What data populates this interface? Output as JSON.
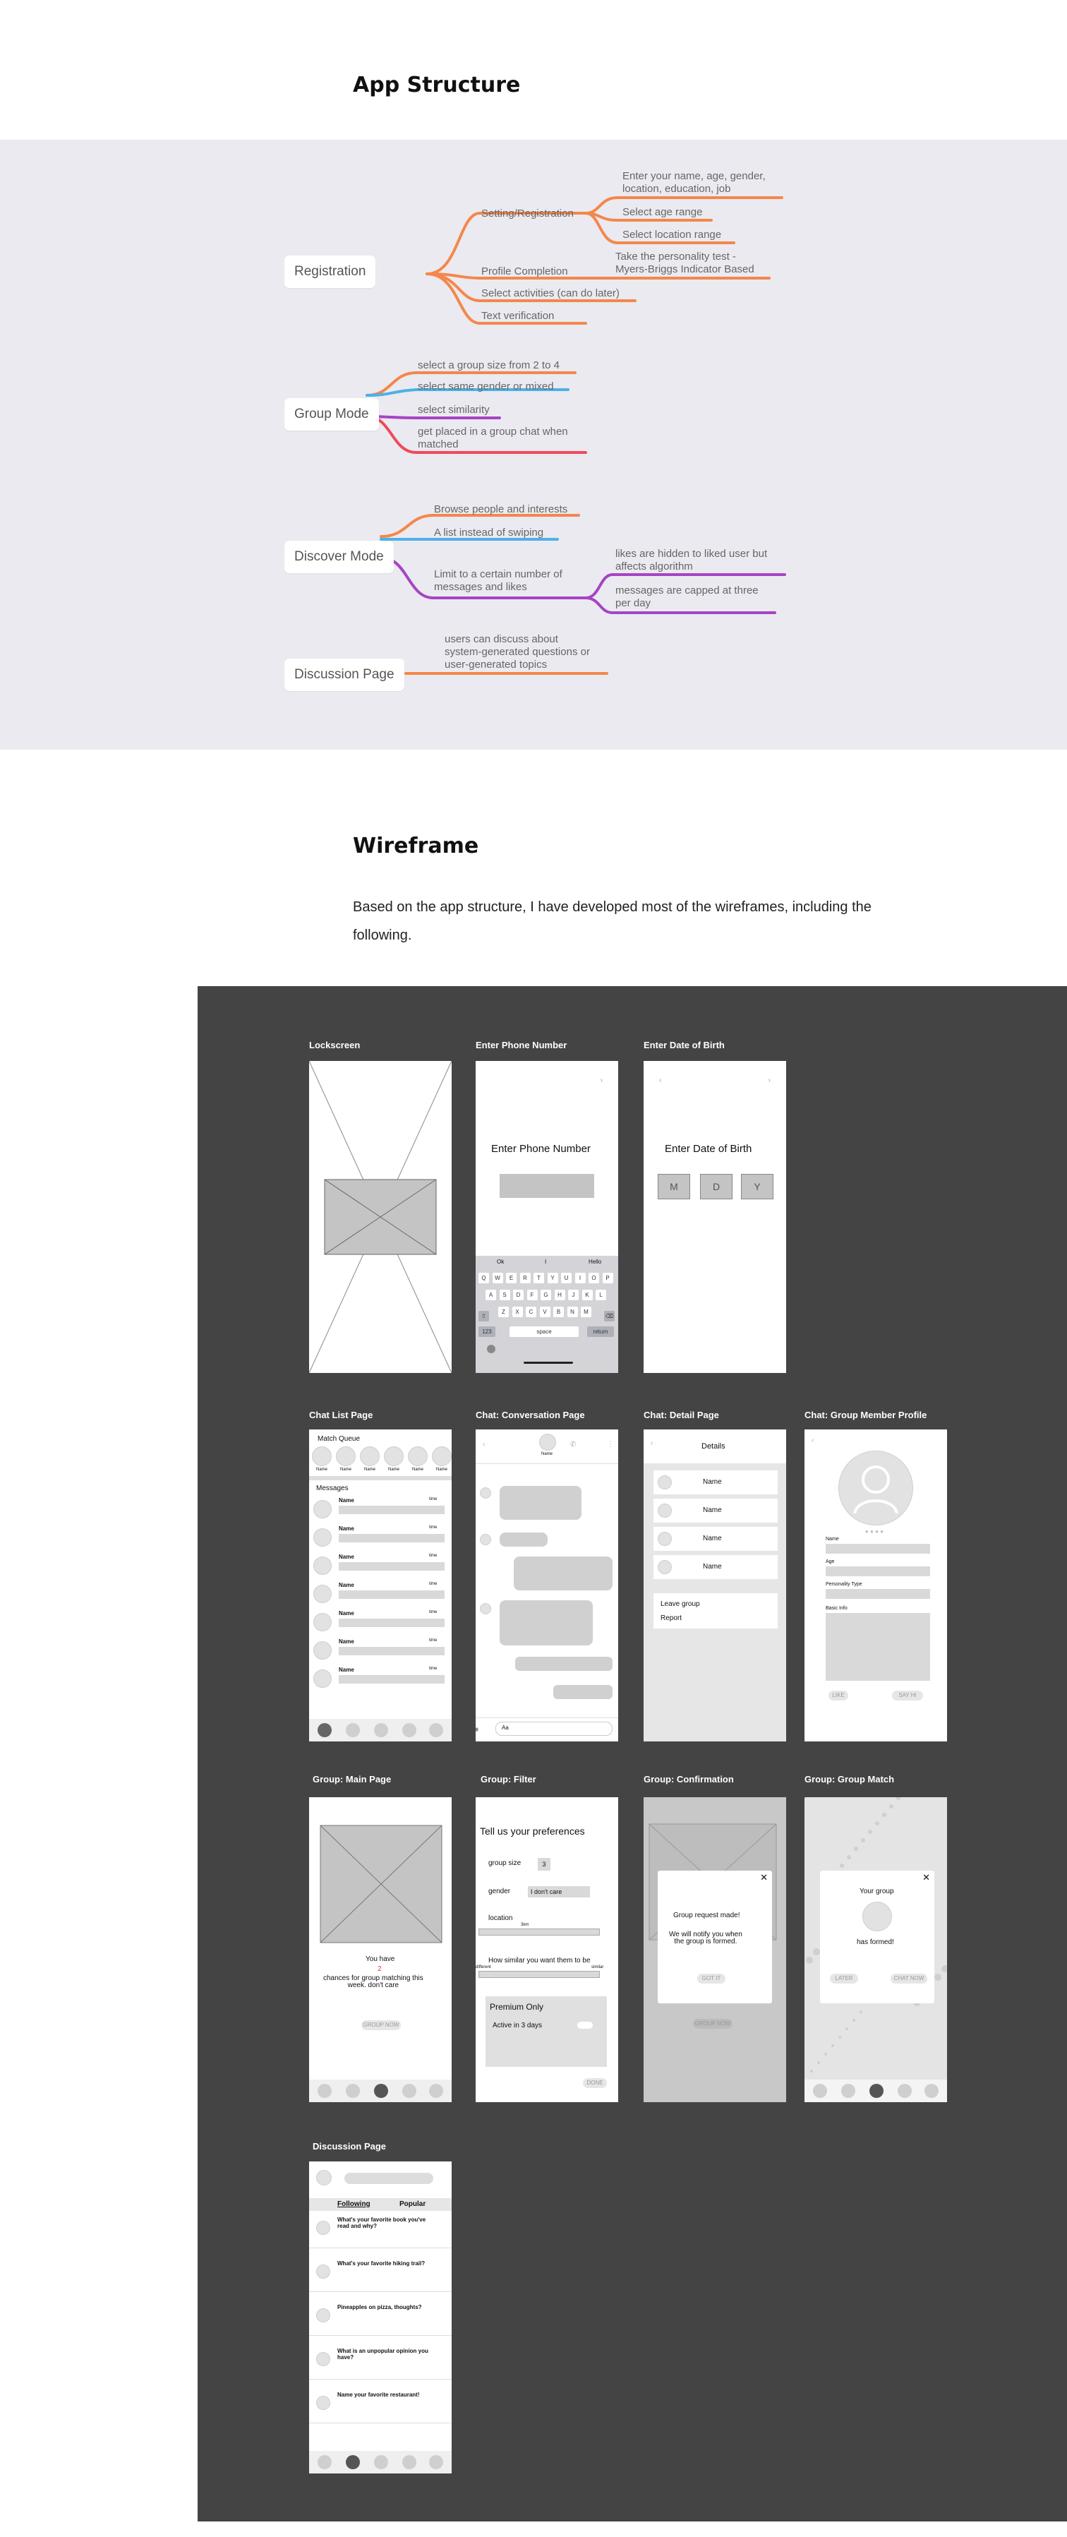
{
  "app_structure": {
    "title": "App Structure",
    "registration": {
      "label": "Registration",
      "setting_registration": "Setting/Registration",
      "enter_details": "Enter your name, age, gender,\nlocation, education, job",
      "age_range": "Select age range",
      "location_range": "Select location range",
      "profile_completion": "Profile Completion",
      "personality_test": "Take the personality test -\nMyers-Briggs Indicator Based",
      "activities": "Select activities (can do later)",
      "text_verification": "Text verification"
    },
    "group_mode": {
      "label": "Group Mode",
      "items": [
        "select a group size from 2 to 4",
        "select same gender or mixed",
        "select similarity",
        "get placed in a group chat when\nmatched"
      ]
    },
    "discover_mode": {
      "label": "Discover Mode",
      "browse": "Browse people and interests",
      "list": "A list instead of swiping",
      "limit": "Limit to a certain number of\nmessages and likes",
      "hidden_likes": "likes are hidden to liked user but\naffects algorithm",
      "capped": "messages are capped at three\nper day"
    },
    "discussion_page": {
      "label": "Discussion Page",
      "desc": "users can discuss about\nsystem-generated questions or\nuser-generated topics"
    },
    "colors": {
      "orange": "#f4874b",
      "blue": "#4db0e8",
      "purple": "#a644c4",
      "red": "#ef4a5a"
    }
  },
  "wireframe": {
    "title": "Wireframe",
    "intro": "Based on the app structure, I have developed most of the wireframes, including the following."
  },
  "screens": {
    "lockscreen": {
      "label": "Lockscreen"
    },
    "phone": {
      "label": "Enter Phone Number",
      "heading": "Enter Phone Number",
      "suggestions": [
        "Ok",
        "I",
        "Hello"
      ],
      "row1": [
        "Q",
        "W",
        "E",
        "R",
        "T",
        "Y",
        "U",
        "I",
        "O",
        "P"
      ],
      "row2": [
        "A",
        "S",
        "D",
        "F",
        "G",
        "H",
        "J",
        "K",
        "L"
      ],
      "row3": [
        "Z",
        "X",
        "C",
        "V",
        "B",
        "N",
        "M"
      ],
      "k123": "123",
      "space": "space",
      "return": "return"
    },
    "dob": {
      "label": "Enter Date of Birth",
      "heading": "Enter Date of Birth",
      "fields": [
        "M",
        "D",
        "Y"
      ]
    },
    "chat_list": {
      "label": "Chat List Page",
      "match_queue": "Match Queue",
      "queue_name": "Name",
      "messages": "Messages",
      "row_name": "Name",
      "row_time": "time"
    },
    "conversation": {
      "label": "Chat: Conversation Page",
      "header_name": "Name",
      "input_placeholder": "Aa"
    },
    "detail": {
      "label": "Chat: Detail Page",
      "header": "Details",
      "members": [
        "Name",
        "Name",
        "Name",
        "Name"
      ],
      "leave": "Leave group",
      "report": "Report"
    },
    "member_profile": {
      "label": "Chat: Group Member Profile",
      "fields": [
        "Name",
        "Age",
        "Personality Type",
        "Basic Info"
      ],
      "like": "LIKE",
      "say_hi": "SAY HI"
    },
    "group_main": {
      "label": "Group: Main Page",
      "you_have": "You have",
      "count": "2",
      "chances": "chances for group matching this\nweek. don't care",
      "button": "GROUP NOW"
    },
    "filter": {
      "label": "Group: Filter",
      "heading": "Tell us your preferences",
      "group_size": "group size",
      "group_size_value": "3",
      "gender": "gender",
      "gender_value": "I don't care",
      "location": "location",
      "location_value": "3km",
      "similarity": "How similar you want them to be",
      "sim_low": "different",
      "sim_high": "similar",
      "premium": "Premium Only",
      "active": "Active in 3 days",
      "done": "DONE"
    },
    "confirmation": {
      "label": "Group: Confirmation",
      "made": "Group request made!",
      "notify": "We will notify you when\nthe group is formed.",
      "got_it": "GOT IT",
      "bg_button": "GROUP NOW"
    },
    "group_match": {
      "label": "Group: Group Match",
      "line1": "Your group",
      "line2": "has formed!",
      "later": "LATER",
      "chat_now": "CHAT NOW"
    },
    "discussion": {
      "label": "Discussion Page",
      "tabs": [
        "Following",
        "Popular"
      ],
      "posts": [
        "What's your favorite book you've\nread and why?",
        "What's your favorite hiking trail?",
        "Pineapples on pizza, thoughts?",
        "What is an unpopular opinion you\nhave?",
        "Name your favorite restaurant!"
      ]
    }
  }
}
